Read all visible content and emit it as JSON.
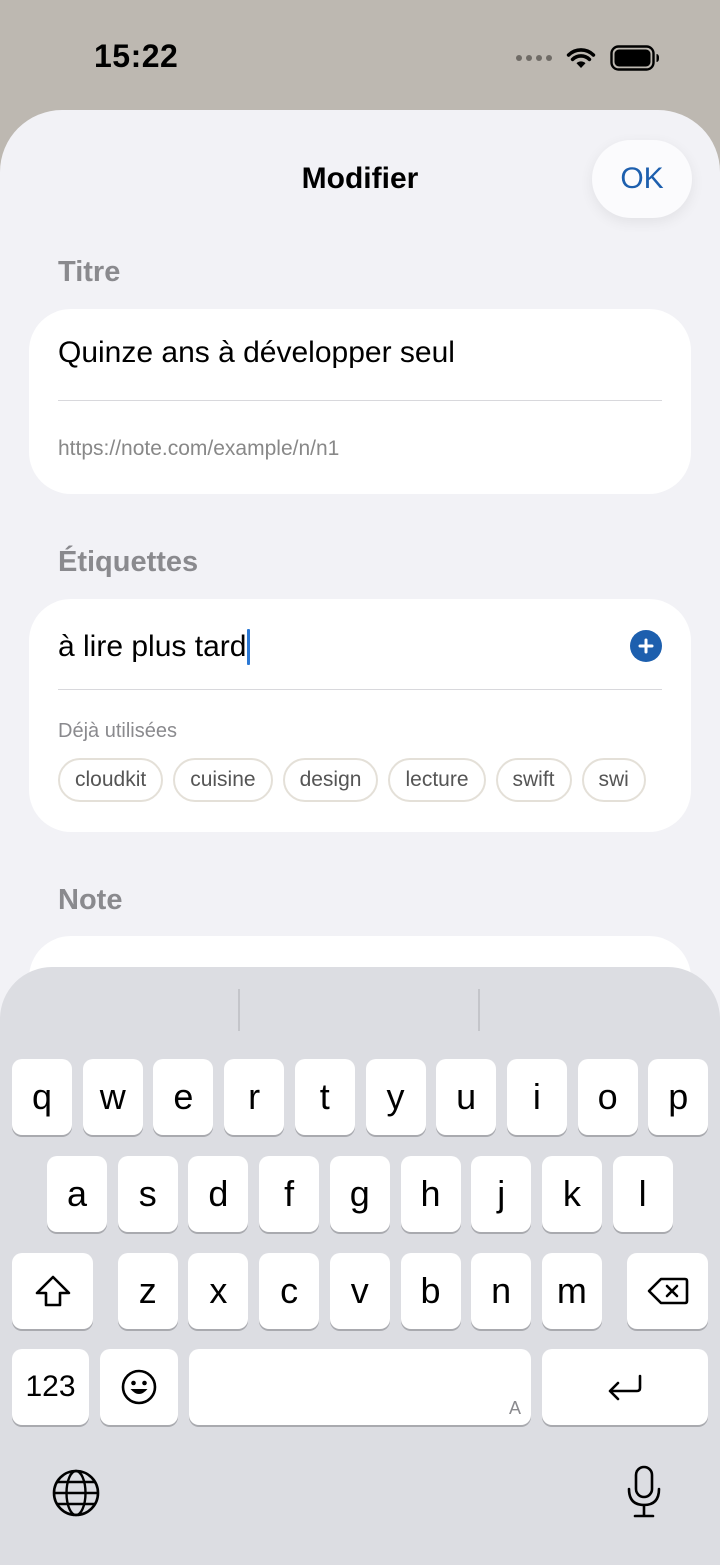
{
  "status_bar": {
    "time": "15:22"
  },
  "nav": {
    "title": "Modifier",
    "ok_label": "OK"
  },
  "title_section": {
    "label": "Titre",
    "title_value": "Quinze ans à développer seul",
    "url_value": "https://note.com/example/n/n1"
  },
  "tags_section": {
    "label": "Étiquettes",
    "input_value": "à lire plus tard",
    "used_label": "Déjà utilisées",
    "chips": [
      "cloudkit",
      "cuisine",
      "design",
      "lecture",
      "swift",
      "swi"
    ]
  },
  "note_section": {
    "label": "Note"
  },
  "keyboard": {
    "row1": [
      "q",
      "w",
      "e",
      "r",
      "t",
      "y",
      "u",
      "i",
      "o",
      "p"
    ],
    "row2": [
      "a",
      "s",
      "d",
      "f",
      "g",
      "h",
      "j",
      "k",
      "l"
    ],
    "row3": [
      "z",
      "x",
      "c",
      "v",
      "b",
      "n",
      "m"
    ],
    "numbers_label": "123",
    "space_hint": "A",
    "icons": [
      "shift-icon",
      "delete-icon",
      "emoji-icon",
      "return-icon",
      "globe-icon",
      "mic-icon"
    ]
  },
  "colors": {
    "accent": "#1d5fae",
    "caret": "#2b78d4",
    "sheet_bg": "#f2f2f6",
    "keyboard_bg": "#dcdde2"
  }
}
